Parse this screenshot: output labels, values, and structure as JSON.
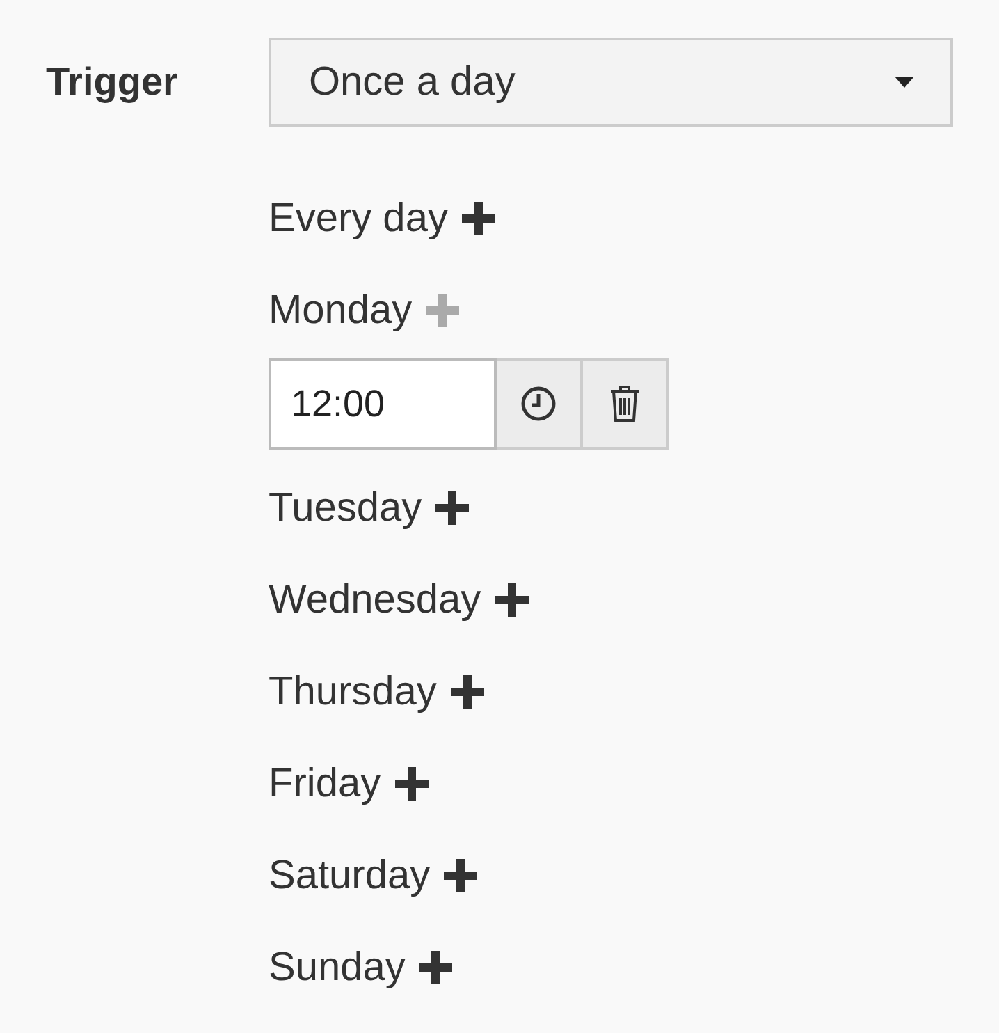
{
  "trigger": {
    "label": "Trigger",
    "value": "Once a day"
  },
  "days": [
    {
      "label": "Every day",
      "add_disabled": false
    },
    {
      "label": "Monday",
      "add_disabled": true,
      "times": [
        {
          "value": "12:00"
        }
      ]
    },
    {
      "label": "Tuesday",
      "add_disabled": false
    },
    {
      "label": "Wednesday",
      "add_disabled": false
    },
    {
      "label": "Thursday",
      "add_disabled": false
    },
    {
      "label": "Friday",
      "add_disabled": false
    },
    {
      "label": "Saturday",
      "add_disabled": false
    },
    {
      "label": "Sunday",
      "add_disabled": false
    }
  ]
}
